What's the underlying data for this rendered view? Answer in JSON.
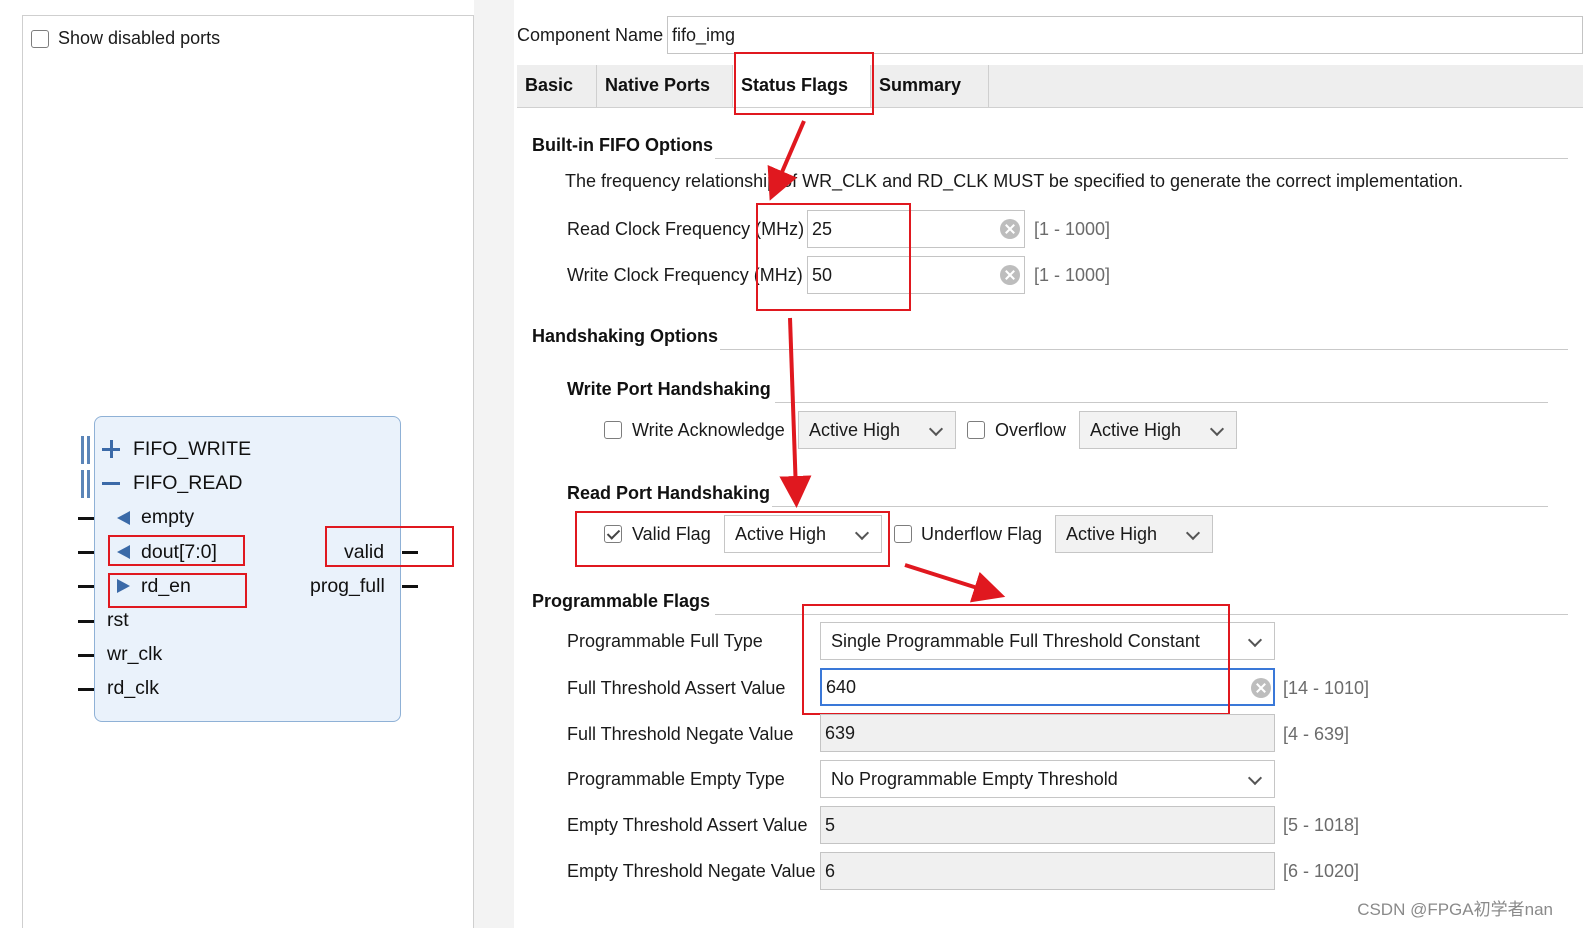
{
  "left": {
    "show_disabled_label": "Show disabled ports",
    "block": {
      "group_write": "FIFO_WRITE",
      "group_read": "FIFO_READ",
      "ports_in": [
        "empty",
        "dout[7:0]",
        "rd_en",
        "rst",
        "wr_clk",
        "rd_clk"
      ],
      "ports_out": [
        "valid",
        "prog_full"
      ]
    }
  },
  "header": {
    "component_name_label": "Component Name",
    "component_name_value": "fifo_img"
  },
  "tabs": [
    {
      "label": "Basic"
    },
    {
      "label": "Native Ports"
    },
    {
      "label": "Status Flags"
    },
    {
      "label": "Summary"
    }
  ],
  "builtin": {
    "title": "Built-in FIFO Options",
    "note": "The frequency relationship of WR_CLK and RD_CLK MUST be specified to generate the correct implementation.",
    "read_clk_label": "Read Clock Frequency (MHz)",
    "read_clk_value": "25",
    "read_clk_range": "[1 - 1000]",
    "write_clk_label": "Write Clock Frequency (MHz)",
    "write_clk_value": "50",
    "write_clk_range": "[1 - 1000]"
  },
  "handshaking": {
    "title": "Handshaking Options",
    "write_port_title": "Write Port Handshaking",
    "write_ack_label": "Write Acknowledge",
    "write_ack_select": "Active High",
    "overflow_label": "Overflow",
    "overflow_select": "Active High",
    "read_port_title": "Read Port Handshaking",
    "valid_label": "Valid Flag",
    "valid_select": "Active High",
    "underflow_label": "Underflow Flag",
    "underflow_select": "Active High"
  },
  "prog_flags": {
    "title": "Programmable Flags",
    "full_type_label": "Programmable Full Type",
    "full_type_value": "Single Programmable Full Threshold Constant",
    "full_assert_label": "Full Threshold Assert Value",
    "full_assert_value": "640",
    "full_assert_range": "[14 - 1010]",
    "full_negate_label": "Full Threshold Negate Value",
    "full_negate_value": "639",
    "full_negate_range": "[4 - 639]",
    "empty_type_label": "Programmable Empty Type",
    "empty_type_value": "No Programmable Empty Threshold",
    "empty_assert_label": "Empty Threshold Assert Value",
    "empty_assert_value": "5",
    "empty_assert_range": "[5 - 1018]",
    "empty_negate_label": "Empty Threshold Negate Value",
    "empty_negate_value": "6",
    "empty_negate_range": "[6 - 1020]"
  },
  "watermark": "CSDN @FPGA初学者nan",
  "colors": {
    "annotation": "#e0181f",
    "block_fill": "#eaf2fb",
    "focus": "#3a78d8"
  }
}
